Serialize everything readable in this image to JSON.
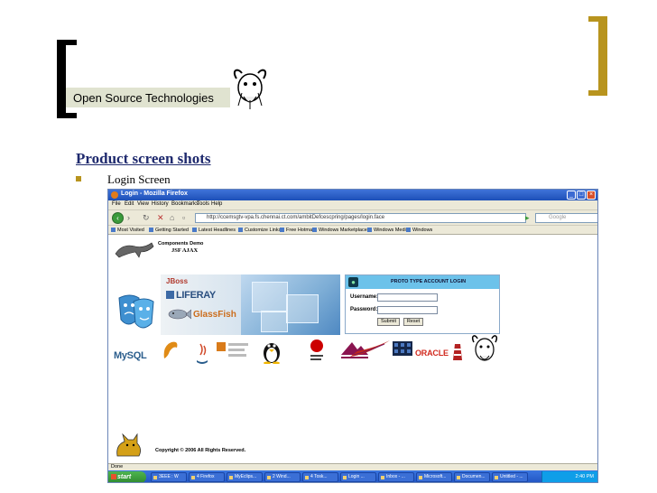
{
  "slide": {
    "title": "Open Source Technologies",
    "heading": "Product screen shots",
    "bullet": "Login Screen",
    "colors": {
      "bracket_left": "#000000",
      "bracket_right": "#b8941e",
      "heading": "#1f2a6e",
      "bullet": "#b8941e"
    },
    "logo_icon": "gnu-head-icon"
  },
  "browser": {
    "window_title": "Login - Mozilla Firefox",
    "menu": [
      "File",
      "Edit",
      "View",
      "History",
      "Bookmarks",
      "Tools",
      "Help"
    ],
    "url": "http://ccemsgtv-vpa.fs.chennai.ct.com/ambitDefcescpring/pages/login.face",
    "search_placeholder": "Google",
    "bookmarks": [
      "Most Visited",
      "Getting Started",
      "Latest Headlines",
      "Customize Links",
      "Free Hotmail",
      "Windows Marketplace",
      "Windows Media",
      "Windows"
    ],
    "status": "Done"
  },
  "page": {
    "components_title": "Components Demo",
    "components_sub": "JSF AJAX",
    "banner": {
      "jboss": "JBoss",
      "liferay": "LIFERAY",
      "glassfish": "GlassFish"
    },
    "login": {
      "title": "PROTO TYPE ACCOUNT LOGIN",
      "username_label": "Username:",
      "password_label": "Password:",
      "submit_label": "Submit",
      "reset_label": "Reset"
    },
    "logos": {
      "mysql_a": "MySQL",
      "oracle": "ORACLE"
    },
    "copyright": "Copyright © 2006 All Rights Reserved."
  },
  "taskbar": {
    "start": "start",
    "items": [
      "3EEE : W",
      "4 Firefox",
      "MyEclips...",
      "2 Wind...",
      "4 Tosk...",
      "Login ...",
      "Inbox - ...",
      "Microsoft...",
      "Documen...",
      "Untitled - ..."
    ],
    "clock": "2:40 PM"
  }
}
